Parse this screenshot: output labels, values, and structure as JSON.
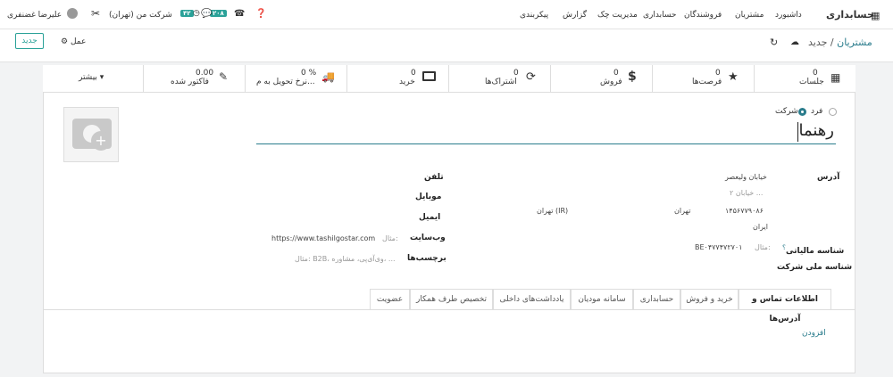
{
  "nav": {
    "app": "حسابداری",
    "items": [
      "داشبورد",
      "مشتریان",
      "فروشندگان",
      "حسابداری",
      "مدیریت چک",
      "گزارش",
      "پیکربندی"
    ]
  },
  "systray": {
    "user": "علیرضا غضنفری",
    "company": "شرکت من (تهران)",
    "badge1": "۴۲",
    "badge2": "۲۰۸"
  },
  "breadcrumb": {
    "parent": "مشتریان",
    "current": "جدید"
  },
  "controls": {
    "new_label": "جدید",
    "action_label": "عمل"
  },
  "stats": [
    {
      "value": "0",
      "label": "جلسات",
      "icon": "calendar-icon"
    },
    {
      "value": "0",
      "label": "فرصت‌ها",
      "icon": "star-icon"
    },
    {
      "value": "0",
      "label": "فروش",
      "icon": "dollar-icon"
    },
    {
      "value": "0",
      "label": "اشتراک‌ها",
      "icon": "refresh-icon"
    },
    {
      "value": "0",
      "label": "خرید",
      "icon": "card-icon"
    },
    {
      "value": "0 %",
      "label": "نرخ تحویل به م...",
      "icon": "truck-icon"
    },
    {
      "value": "0.00",
      "label": "فاکتور شده",
      "icon": "edit-icon"
    },
    {
      "value": "",
      "label": "بیشتر ▾",
      "icon": ""
    }
  ],
  "form": {
    "type_person": "فرد",
    "type_company": "شرکت",
    "name": "رهنما",
    "address_label": "آدرس",
    "street": "خیابان ولیعصر",
    "street2_ph": "خیابان ۲ ...",
    "city": "تهران",
    "state": "تهران (IR)",
    "zip": "۱۴۵۶۷۷۹۰۸۶",
    "country": "ایران",
    "tax_label": "شناسه مالیاتی",
    "tax_sup": "؟",
    "tax_ph": "مثال:",
    "tax_value": "BE۰۴۷۷۴۷۲۷۰۱",
    "national_label": "شناسه ملی شرکت",
    "phone_label": "تلفن",
    "mobile_label": "موبایل",
    "email_label": "ایمیل",
    "website_label": "وب‌سایت",
    "website_ph": "مثال:",
    "website_value": "https://www.tashilgostar.com",
    "tags_label": "برچسب‌ها",
    "tags_ph": "مثال: B2B، وی‌آی‌پی، مشاوره، ..."
  },
  "tabs": [
    "اطلاعات تماس و آدرس‌ها",
    "خرید و فروش",
    "حسابداری",
    "سامانه مودیان",
    "یادداشت‌های داخلی",
    "تخصیص طرف همکار",
    "عضویت"
  ],
  "add_label": "افزودن"
}
